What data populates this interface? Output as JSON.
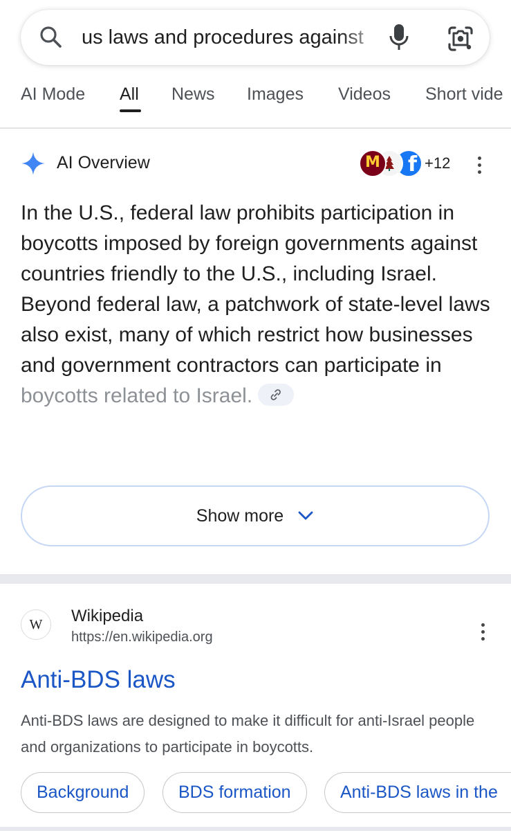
{
  "search": {
    "query": "us laws and procedures against"
  },
  "tabs": [
    {
      "label": "AI Mode"
    },
    {
      "label": "All"
    },
    {
      "label": "News"
    },
    {
      "label": "Images"
    },
    {
      "label": "Videos"
    },
    {
      "label": "Short vide"
    }
  ],
  "ai_overview": {
    "title": "AI Overview",
    "source_count": "+12",
    "favicon_letters": {
      "umn": "M",
      "facebook": "f"
    },
    "paragraph": "In the U.S., federal law prohibits participation in boycotts imposed by foreign governments against countries friendly to the U.S., including Israel. Beyond federal law, a patchwork of state-level laws also exist, many of which restrict how businesses and government contractors can participate in",
    "paragraph_faded": "boycotts related to Israel.",
    "show_more_label": "Show more"
  },
  "result": {
    "logo_letter": "W",
    "site_name": "Wikipedia",
    "url": "https://en.wikipedia.org",
    "title": "Anti-BDS laws",
    "snippet": "Anti-BDS laws are designed to make it difficult for anti-Israel people and organizations to participate in boycotts.",
    "chips": [
      {
        "label": "Background"
      },
      {
        "label": "BDS formation"
      },
      {
        "label": "Anti-BDS laws in the"
      }
    ]
  },
  "colors": {
    "link_blue": "#1a56c6",
    "ai_spark_blue": "#4285f4",
    "umn_maroon": "#7a0019",
    "facebook_blue": "#1877f2"
  }
}
